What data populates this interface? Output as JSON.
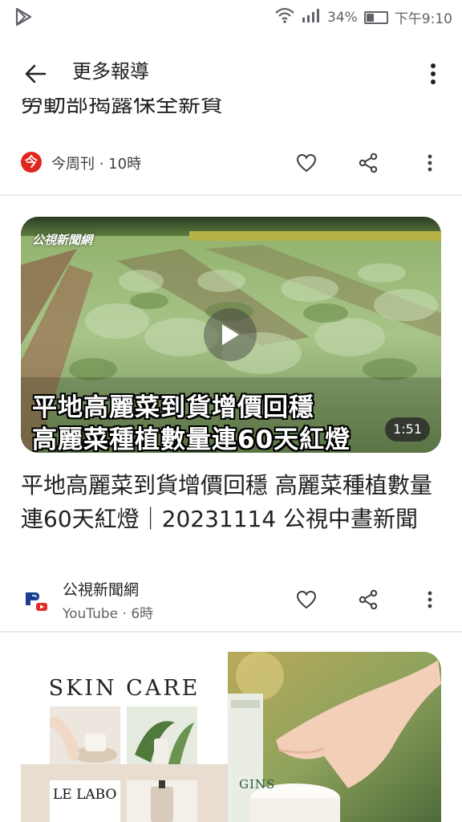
{
  "status_bar": {
    "battery": "34%",
    "time": "下午9:10",
    "battery_level": 0.34
  },
  "app_bar": {
    "title": "更多報導"
  },
  "cards": [
    {
      "headline_partial": "勞動部揭露保全薪資",
      "source_badge": "今",
      "source_meta": "今周刊 · 10時"
    },
    {
      "thumbnail_logo": "公視新聞網",
      "caption_line1": "平地高麗菜到貨增價回穩",
      "caption_line2": "高麗菜種植數量連60天紅燈",
      "duration": "1:51",
      "headline": "平地高麗菜到貨增價回穩 高麗菜種植數量連60天紅燈｜20231114 公視中晝新聞",
      "source_name": "公視新聞網",
      "source_sub": "YouTube · 6時"
    },
    {
      "ad_title": "SKIN  CARE",
      "ad_brand_1": "LE LABO",
      "ad_brand_2": "GINS"
    }
  ],
  "colors": {
    "accent_red": "#e0271f",
    "divider": "#e8eaed",
    "text_primary": "#202124",
    "text_secondary": "#5f6368"
  },
  "icons": [
    "play-store-icon",
    "wifi-icon",
    "signal-icon",
    "battery-icon",
    "back-arrow-icon",
    "more-vert-icon",
    "heart-icon",
    "share-icon",
    "play-icon"
  ]
}
